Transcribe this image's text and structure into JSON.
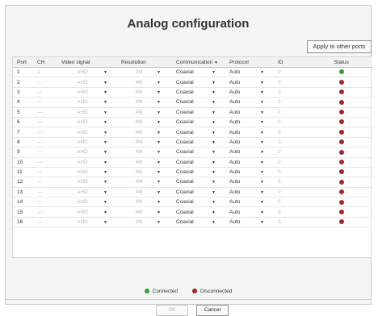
{
  "dialog": {
    "title": "Analog configuration",
    "apply_label": "Apply to other ports"
  },
  "columns": {
    "port": "Port",
    "ch": "CH",
    "video": "Video signal",
    "resolution": "Resolution",
    "communication": "Communication",
    "protocol": "Protocol",
    "id": "ID",
    "status": "Status"
  },
  "rows": [
    {
      "port": "1",
      "ch": "1",
      "video": "AHD",
      "resolution": "2M",
      "communication": "Coaxial",
      "protocol": "Auto",
      "id": "0",
      "status": "connected"
    },
    {
      "port": "2",
      "ch": "—",
      "video": "AHD",
      "resolution": "4M",
      "communication": "Coaxial",
      "protocol": "Auto",
      "id": "0",
      "status": "disconnected"
    },
    {
      "port": "3",
      "ch": "—",
      "video": "AHD",
      "resolution": "4M",
      "communication": "Coaxial",
      "protocol": "Auto",
      "id": "0",
      "status": "disconnected"
    },
    {
      "port": "4",
      "ch": "—",
      "video": "AHD",
      "resolution": "4M",
      "communication": "Coaxial",
      "protocol": "Auto",
      "id": "0",
      "status": "disconnected"
    },
    {
      "port": "5",
      "ch": "—",
      "video": "AHD",
      "resolution": "4M",
      "communication": "Coaxial",
      "protocol": "Auto",
      "id": "0",
      "status": "disconnected"
    },
    {
      "port": "6",
      "ch": "—",
      "video": "AHD",
      "resolution": "4M",
      "communication": "Coaxial",
      "protocol": "Auto",
      "id": "0",
      "status": "disconnected"
    },
    {
      "port": "7",
      "ch": "—",
      "video": "AHD",
      "resolution": "4M",
      "communication": "Coaxial",
      "protocol": "Auto",
      "id": "0",
      "status": "disconnected"
    },
    {
      "port": "8",
      "ch": "—",
      "video": "AHD",
      "resolution": "4M",
      "communication": "Coaxial",
      "protocol": "Auto",
      "id": "0",
      "status": "disconnected"
    },
    {
      "port": "9",
      "ch": "—",
      "video": "AHD",
      "resolution": "4M",
      "communication": "Coaxial",
      "protocol": "Auto",
      "id": "0",
      "status": "disconnected"
    },
    {
      "port": "10",
      "ch": "—",
      "video": "AHD",
      "resolution": "4M",
      "communication": "Coaxial",
      "protocol": "Auto",
      "id": "0",
      "status": "disconnected"
    },
    {
      "port": "11",
      "ch": "—",
      "video": "AHD",
      "resolution": "4M",
      "communication": "Coaxial",
      "protocol": "Auto",
      "id": "0",
      "status": "disconnected"
    },
    {
      "port": "12",
      "ch": "—",
      "video": "AHD",
      "resolution": "4M",
      "communication": "Coaxial",
      "protocol": "Auto",
      "id": "0",
      "status": "disconnected"
    },
    {
      "port": "13",
      "ch": "—",
      "video": "AHD",
      "resolution": "4M",
      "communication": "Coaxial",
      "protocol": "Auto",
      "id": "0",
      "status": "disconnected"
    },
    {
      "port": "14",
      "ch": "—",
      "video": "AHD",
      "resolution": "4M",
      "communication": "Coaxial",
      "protocol": "Auto",
      "id": "0",
      "status": "disconnected"
    },
    {
      "port": "15",
      "ch": "—",
      "video": "AHD",
      "resolution": "4M",
      "communication": "Coaxial",
      "protocol": "Auto",
      "id": "0",
      "status": "disconnected"
    },
    {
      "port": "16",
      "ch": "—",
      "video": "AHD",
      "resolution": "4M",
      "communication": "Coaxial",
      "protocol": "Auto",
      "id": "0",
      "status": "disconnected"
    }
  ],
  "legend": {
    "connected": "Connected",
    "disconnected": "Disconnected"
  },
  "colors": {
    "connected": "#3a9a3a",
    "disconnected": "#a3262a"
  },
  "buttons": {
    "ok": "OK",
    "cancel": "Cancel"
  },
  "icons": {
    "dropdown": "chevron-down-icon",
    "status": "status-dot-icon"
  }
}
